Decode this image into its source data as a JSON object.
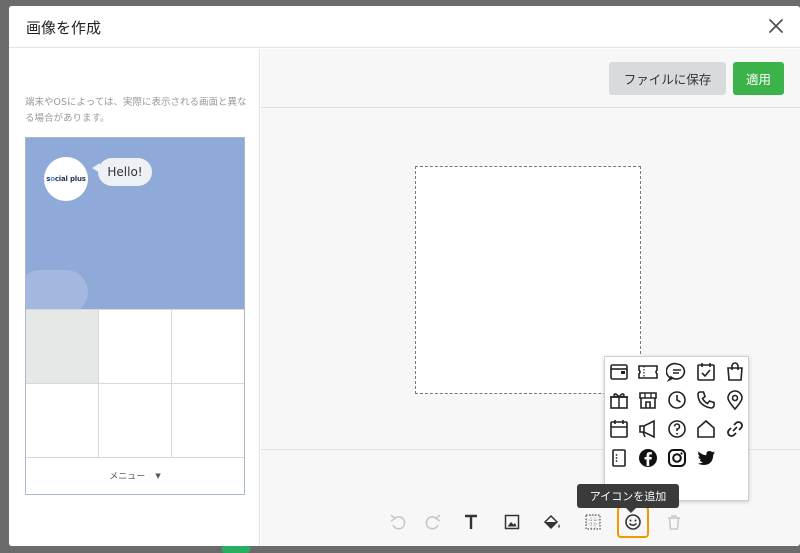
{
  "modal": {
    "title": "画像を作成"
  },
  "preview_panel": {
    "note": "端末やOSによっては、実際に表示される画面と異なる場合があります。",
    "chat": {
      "logo_text": "social plus",
      "bubble_text": "Hello!"
    },
    "menu_label": "メニュー"
  },
  "editor": {
    "save_label": "ファイルに保存",
    "apply_label": "適用",
    "tooltip": "アイコンを追加"
  },
  "colors": {
    "accent_green": "#3cb34a",
    "highlight_orange": "#f39800",
    "chat_background": "#8fa9d8"
  },
  "toolbar_icons": [
    "undo-icon",
    "redo-icon",
    "text-icon",
    "image-icon",
    "fill-icon",
    "grid-icon",
    "smiley-icon",
    "trash-icon"
  ],
  "icon_picker": [
    "card-icon",
    "ticket-icon",
    "chat-icon",
    "calendar-check-icon",
    "shopping-bag-icon",
    "gift-icon",
    "store-icon",
    "clock-icon",
    "phone-icon",
    "location-pin-icon",
    "calendar-icon",
    "megaphone-icon",
    "help-icon",
    "home-icon",
    "link-icon",
    "menu-book-icon",
    "facebook-icon",
    "instagram-icon",
    "twitter-icon"
  ]
}
